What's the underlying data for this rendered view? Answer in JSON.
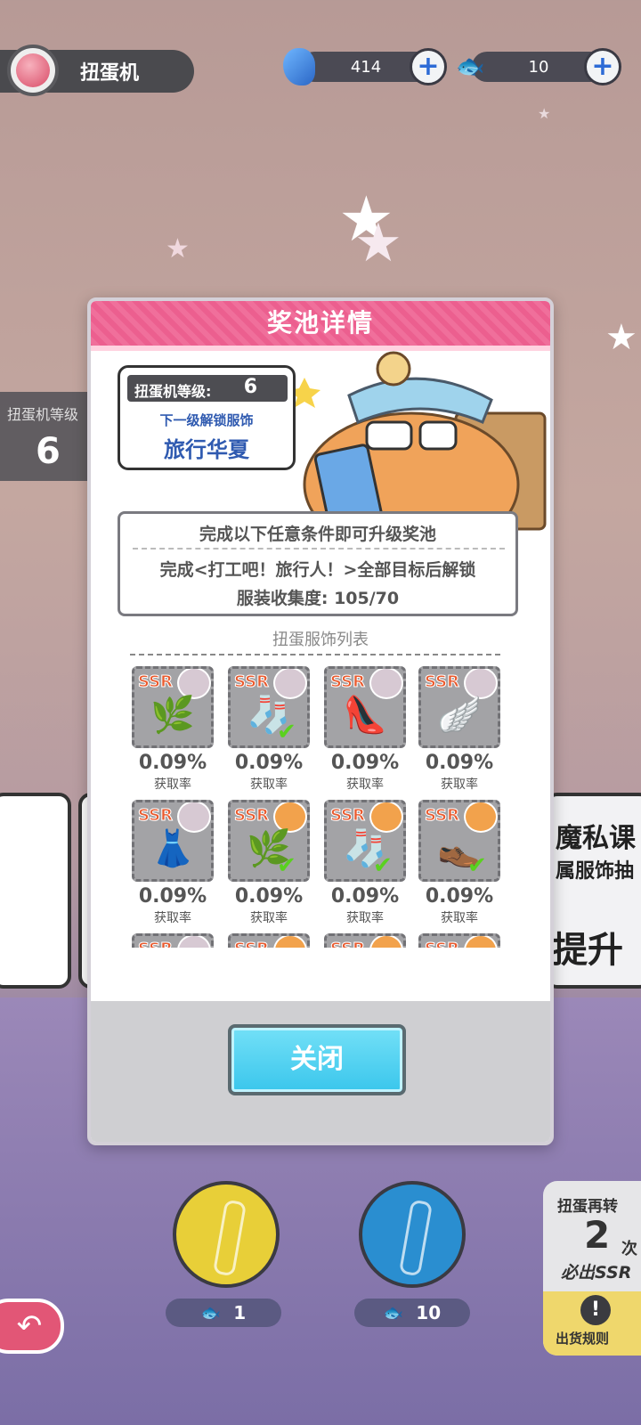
{
  "header": {
    "title": "扭蛋机",
    "currency1": {
      "value": "414",
      "icon": "fish-currency-icon"
    },
    "currency2": {
      "value": "10",
      "icon": "dried-fish-ticket-icon"
    }
  },
  "background": {
    "level_label": "扭蛋机等级",
    "level_value": "6",
    "right_panel_line1": "魔私课",
    "right_panel_line2": "属服饰抽",
    "right_panel_line3": "提升"
  },
  "modal": {
    "title": "奖池详情",
    "level_label": "扭蛋机等级:",
    "level_value": "6",
    "next_unlock_label": "下一级解锁服饰",
    "next_unlock_value": "旅行华夏",
    "condition_title": "完成以下任意条件即可升级奖池",
    "condition_line1": "完成<打工吧！旅行人！>全部目标后解锁",
    "condition_line2": "服装收集度: 105/70",
    "list_title": "扭蛋服饰列表",
    "items": [
      {
        "rarity": "SSR",
        "rate": "0.09%",
        "rate_label": "获取率",
        "art": "🌿",
        "avatar": "girl",
        "owned": false
      },
      {
        "rarity": "SSR",
        "rate": "0.09%",
        "rate_label": "获取率",
        "art": "🧦",
        "avatar": "girl",
        "owned": true
      },
      {
        "rarity": "SSR",
        "rate": "0.09%",
        "rate_label": "获取率",
        "art": "👠",
        "avatar": "girl",
        "owned": false
      },
      {
        "rarity": "SSR",
        "rate": "0.09%",
        "rate_label": "获取率",
        "art": "🪽",
        "avatar": "girl",
        "owned": false
      },
      {
        "rarity": "SSR",
        "rate": "0.09%",
        "rate_label": "获取率",
        "art": "👗",
        "avatar": "girl",
        "owned": false
      },
      {
        "rarity": "SSR",
        "rate": "0.09%",
        "rate_label": "获取率",
        "art": "🌿",
        "avatar": "cat",
        "owned": true
      },
      {
        "rarity": "SSR",
        "rate": "0.09%",
        "rate_label": "获取率",
        "art": "🧦",
        "avatar": "cat",
        "owned": true
      },
      {
        "rarity": "SSR",
        "rate": "0.09%",
        "rate_label": "获取率",
        "art": "👞",
        "avatar": "cat",
        "owned": true
      },
      {
        "rarity": "SSR",
        "rate": "",
        "rate_label": "",
        "art": "",
        "avatar": "girl",
        "owned": false
      },
      {
        "rarity": "SSR",
        "rate": "",
        "rate_label": "",
        "art": "",
        "avatar": "cat",
        "owned": false
      },
      {
        "rarity": "SSR",
        "rate": "",
        "rate_label": "",
        "art": "",
        "avatar": "cat",
        "owned": false
      },
      {
        "rarity": "SSR",
        "rate": "",
        "rate_label": "",
        "art": "",
        "avatar": "cat",
        "owned": false
      }
    ],
    "close_label": "关闭"
  },
  "bottom": {
    "single_cost": "1",
    "multi_cost": "10",
    "guarantee_label": "扭蛋再转",
    "guarantee_count": "2",
    "guarantee_unit": "次",
    "guarantee_result": "必出SSR",
    "rules_label": "出货规则"
  },
  "colors": {
    "modal_header": "#ec5f8f",
    "close_button": "#3ac6ec",
    "level_text": "#2f5ab0"
  }
}
